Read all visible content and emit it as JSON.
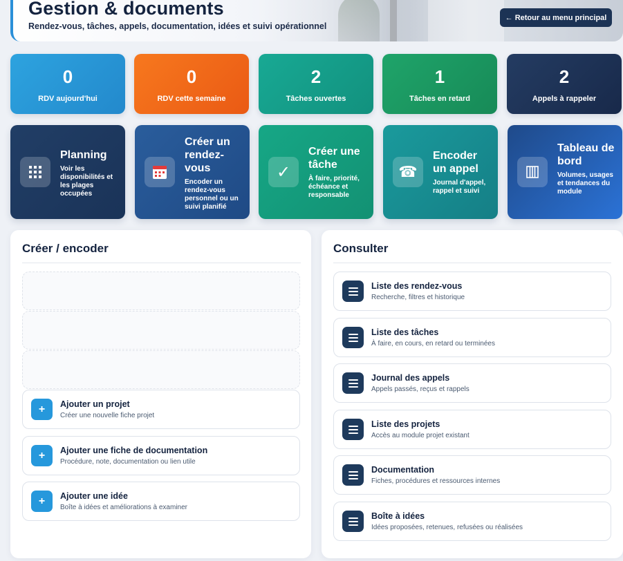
{
  "header": {
    "title": "Gestion & documents",
    "subtitle": "Rendez-vous, tâches, appels, documentation, idées et suivi opérationnel",
    "back_label": "← Retour au menu principal"
  },
  "stats": [
    {
      "value": "0",
      "label": "RDV aujourd'hui",
      "color": "#2a9ad8"
    },
    {
      "value": "0",
      "label": "RDV cette semaine",
      "color": "#f26a1b"
    },
    {
      "value": "2",
      "label": "Tâches ouvertes",
      "color": "#16a08a"
    },
    {
      "value": "1",
      "label": "Tâches en retard",
      "color": "#1c9a62"
    },
    {
      "value": "2",
      "label": "Appels à rappeler",
      "color": "#1f3558"
    }
  ],
  "actions": [
    {
      "title": "Planning",
      "desc": "Voir les disponibilités et les plages occupées",
      "icon": "grid-icon"
    },
    {
      "title": "Créer un rendez-vous",
      "desc": "Encoder un rendez-vous personnel ou un suivi planifié",
      "icon": "calendar-icon"
    },
    {
      "title": "Créer une tâche",
      "desc": "À faire, priorité, échéance et responsable",
      "icon": "checkmark-icon"
    },
    {
      "title": "Encoder un appel",
      "desc": "Journal d'appel, rappel et suivi",
      "icon": "phone-icon"
    },
    {
      "title": "Tableau de bord",
      "desc": "Volumes, usages et tendances du module",
      "icon": "columns-icon"
    }
  ],
  "create_panel": {
    "title": "Créer / encoder",
    "items": [
      {
        "title": "Ajouter un projet",
        "desc": "Créer une nouvelle fiche projet",
        "icon": "plus-icon"
      },
      {
        "title": "Ajouter une fiche de documentation",
        "desc": "Procédure, note, documentation ou lien utile",
        "icon": "plus-icon"
      },
      {
        "title": "Ajouter une idée",
        "desc": "Boîte à idées et améliorations à examiner",
        "icon": "plus-icon"
      }
    ]
  },
  "consult_panel": {
    "title": "Consulter",
    "items": [
      {
        "title": "Liste des rendez-vous",
        "desc": "Recherche, filtres et historique",
        "icon": "list-icon"
      },
      {
        "title": "Liste des tâches",
        "desc": "À faire, en cours, en retard ou terminées",
        "icon": "list-icon"
      },
      {
        "title": "Journal des appels",
        "desc": "Appels passés, reçus et rappels",
        "icon": "list-icon"
      },
      {
        "title": "Liste des projets",
        "desc": "Accès au module projet existant",
        "icon": "list-icon"
      },
      {
        "title": "Documentation",
        "desc": "Fiches, procédures et ressources internes",
        "icon": "list-icon"
      },
      {
        "title": "Boîte à idées",
        "desc": "Idées proposées, retenues, refusées ou réalisées",
        "icon": "list-icon"
      }
    ]
  }
}
